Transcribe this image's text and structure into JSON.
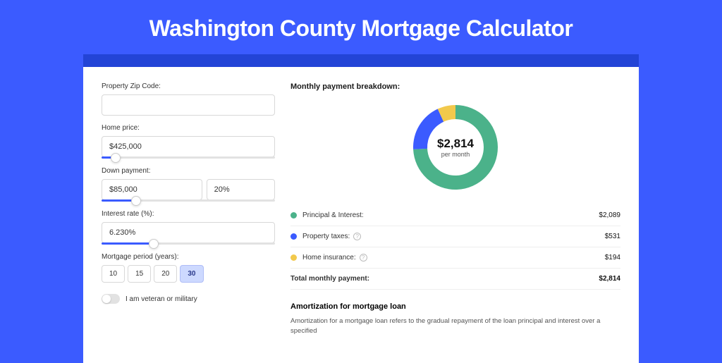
{
  "page_title": "Washington County Mortgage Calculator",
  "form": {
    "zip_label": "Property Zip Code:",
    "zip_value": "",
    "home_price_label": "Home price:",
    "home_price_value": "$425,000",
    "home_price_slider_pct": 8,
    "down_payment_label": "Down payment:",
    "down_payment_amount": "$85,000",
    "down_payment_pct": "20%",
    "down_payment_slider_pct": 20,
    "interest_rate_label": "Interest rate (%):",
    "interest_rate_value": "6.230%",
    "interest_rate_slider_pct": 30,
    "period_label": "Mortgage period (years):",
    "periods": [
      "10",
      "15",
      "20",
      "30"
    ],
    "period_selected": "30",
    "veteran_label": "I am veteran or military"
  },
  "breakdown": {
    "title": "Monthly payment breakdown:",
    "center_amount": "$2,814",
    "center_sub": "per month",
    "items": [
      {
        "label": "Principal & Interest:",
        "value": "$2,089",
        "color": "c-green",
        "info": false
      },
      {
        "label": "Property taxes:",
        "value": "$531",
        "color": "c-blue",
        "info": true
      },
      {
        "label": "Home insurance:",
        "value": "$194",
        "color": "c-yellow",
        "info": true
      }
    ],
    "total_label": "Total monthly payment:",
    "total_value": "$2,814"
  },
  "chart_data": {
    "type": "pie",
    "title": "Monthly payment breakdown",
    "series": [
      {
        "name": "Principal & Interest",
        "value": 2089,
        "color": "#4bb28a"
      },
      {
        "name": "Property taxes",
        "value": 531,
        "color": "#3b5bff"
      },
      {
        "name": "Home insurance",
        "value": 194,
        "color": "#f2c94c"
      }
    ],
    "total": 2814,
    "center_label": "$2,814 per month"
  },
  "amortization": {
    "title": "Amortization for mortgage loan",
    "text": "Amortization for a mortgage loan refers to the gradual repayment of the loan principal and interest over a specified"
  }
}
